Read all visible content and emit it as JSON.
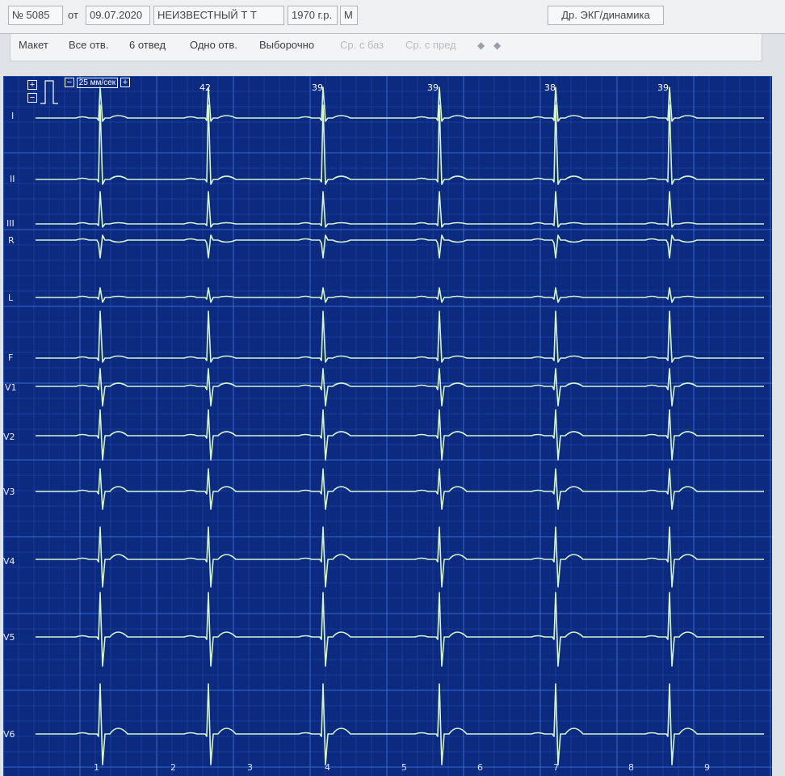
{
  "header": {
    "record_no": "№ 5085",
    "from_label": "от",
    "date": "09.07.2020",
    "patient_name": "НЕИЗВЕСТНЫЙ Т Т",
    "birth_year": "1970 г.р.",
    "sex": "М",
    "dynamics_button": "Др. ЭКГ/динамика"
  },
  "toolbar": {
    "items": [
      {
        "label": "Макет",
        "enabled": true
      },
      {
        "label": "Все отв.",
        "enabled": true
      },
      {
        "label": "6 отвед",
        "enabled": true
      },
      {
        "label": "Одно отв.",
        "enabled": true
      },
      {
        "label": "Выборочно",
        "enabled": true
      },
      {
        "label": "Ср. с баз",
        "enabled": false
      },
      {
        "label": "Ср. с пред",
        "enabled": false
      }
    ],
    "nav_icons": [
      "nav-prev-icon",
      "nav-next-icon"
    ]
  },
  "ecg": {
    "speed_label": "25 мм/сек",
    "heart_rates": [
      "42",
      "39",
      "39",
      "38",
      "39"
    ],
    "seconds": [
      "1",
      "2",
      "3",
      "4",
      "5",
      "6",
      "7",
      "8",
      "9"
    ],
    "leads": [
      "I",
      "II",
      "III",
      "R",
      "L",
      "F",
      "V1",
      "V2",
      "V3",
      "V4",
      "V5",
      "V6"
    ],
    "grid_color": "#3b6fd8",
    "background_color": "#0b2a80",
    "trace_color": "#d6f5d0"
  }
}
